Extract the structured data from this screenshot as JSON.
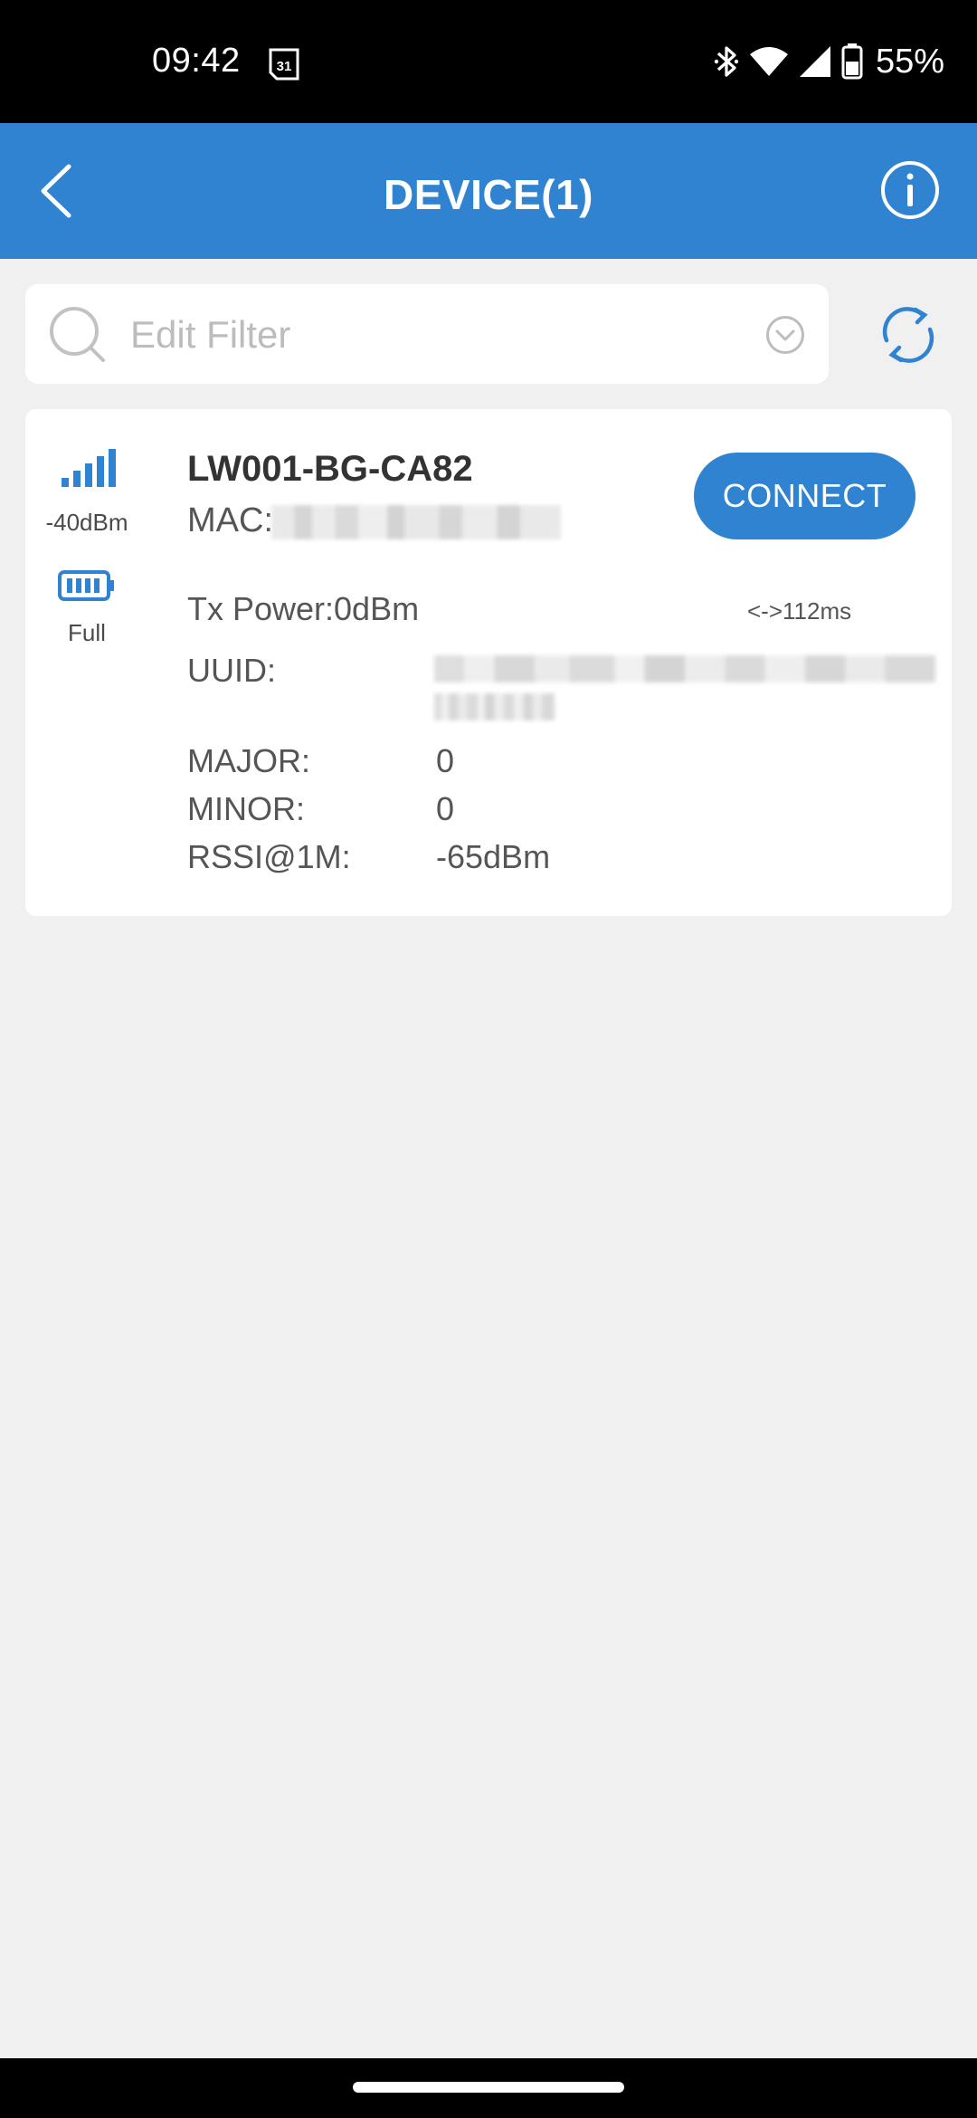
{
  "status_bar": {
    "time": "09:42",
    "calendar_day": "31",
    "battery_percent": "55%",
    "icons": [
      "bluetooth-icon",
      "wifi-icon",
      "cellular-signal-icon",
      "battery-icon"
    ]
  },
  "header": {
    "title": "DEVICE(1)",
    "back_icon": "chevron-left-icon",
    "info_icon": "info-circle-icon",
    "background_color": "#2f83d1"
  },
  "filter": {
    "placeholder": "Edit Filter",
    "value": "",
    "search_icon": "search-icon",
    "dropdown_icon": "chevron-down-circle-icon",
    "refresh_icon": "refresh-icon"
  },
  "device": {
    "rssi": "-40dBm",
    "battery": "Full",
    "name": "LW001-BG-CA82",
    "mac_label": "MAC:",
    "connect_label": "CONNECT",
    "tx_power": "Tx Power:0dBm",
    "interval": "<->112ms",
    "uuid_label": "UUID:",
    "major_label": "MAJOR:",
    "major_value": "0",
    "minor_label": "MINOR:",
    "minor_value": "0",
    "rssi1m_label": "RSSI@1M:",
    "rssi1m_value": "-65dBm",
    "accent_color": "#2f83d1"
  }
}
